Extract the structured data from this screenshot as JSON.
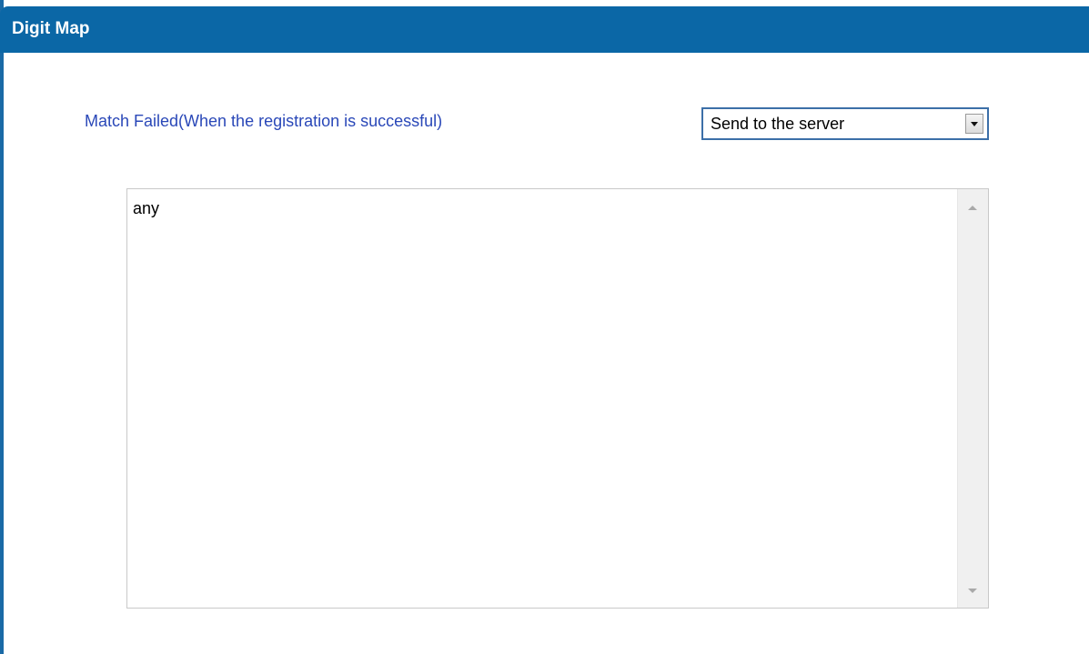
{
  "panel": {
    "title": "Digit Map"
  },
  "match_failed": {
    "label": "Match Failed(When the registration is successful)",
    "selected": "Send to the server"
  },
  "digit_map_text": {
    "value": "any"
  },
  "colors": {
    "header": "#0b67a6",
    "label": "#2a48b8",
    "select_border": "#3c6fa8"
  },
  "icons": {
    "dropdown": "chevron-down-icon",
    "scroll_up": "scroll-up-icon",
    "scroll_down": "scroll-down-icon"
  }
}
